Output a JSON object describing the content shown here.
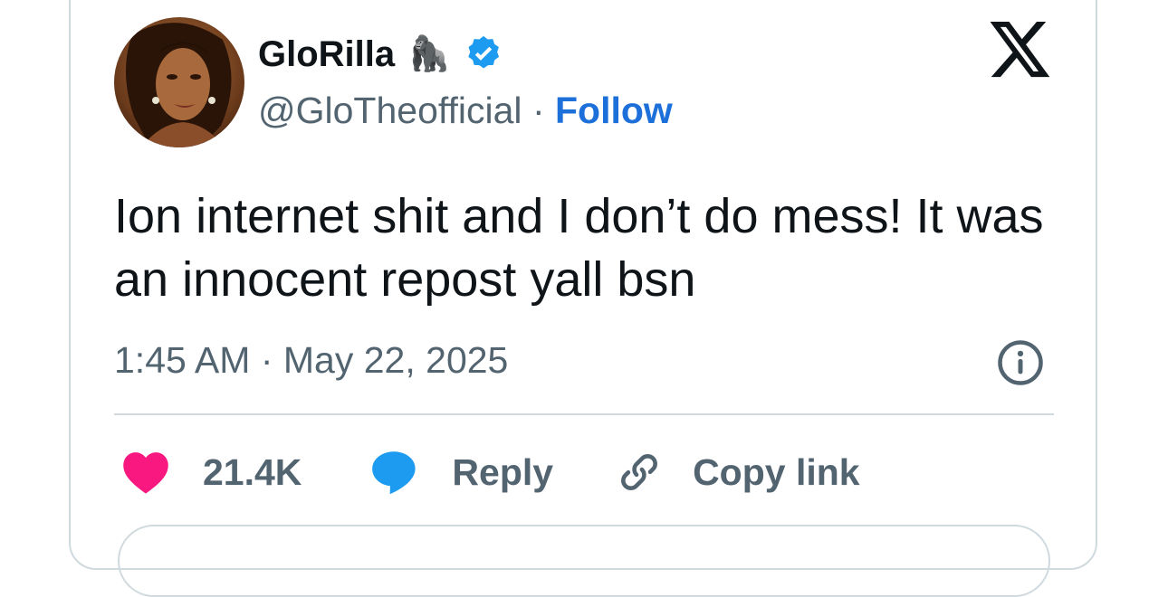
{
  "author": {
    "display_name": "GloRilla",
    "emoji": "🦍",
    "handle": "@GloTheofficial",
    "separator": "·",
    "follow_label": "Follow"
  },
  "tweet": {
    "text": "Ion internet shit and I don’t do mess! It was an innocent repost yall bsn",
    "time": "1:45 AM",
    "separator": "·",
    "date": "May 22, 2025"
  },
  "actions": {
    "likes_count": "21.4K",
    "reply_label": "Reply",
    "copy_link_label": "Copy link"
  },
  "colors": {
    "like": "#f91880",
    "reply": "#1d9bf0",
    "follow": "#1d6fd9",
    "verified": "#1d9bf0",
    "secondary_text": "#536471",
    "border": "#cfd9de"
  },
  "icons": {
    "brand": "x-logo-icon",
    "verified": "verified-badge-icon",
    "info": "info-icon",
    "like": "heart-icon",
    "reply": "speech-bubble-icon",
    "copy": "link-icon"
  }
}
